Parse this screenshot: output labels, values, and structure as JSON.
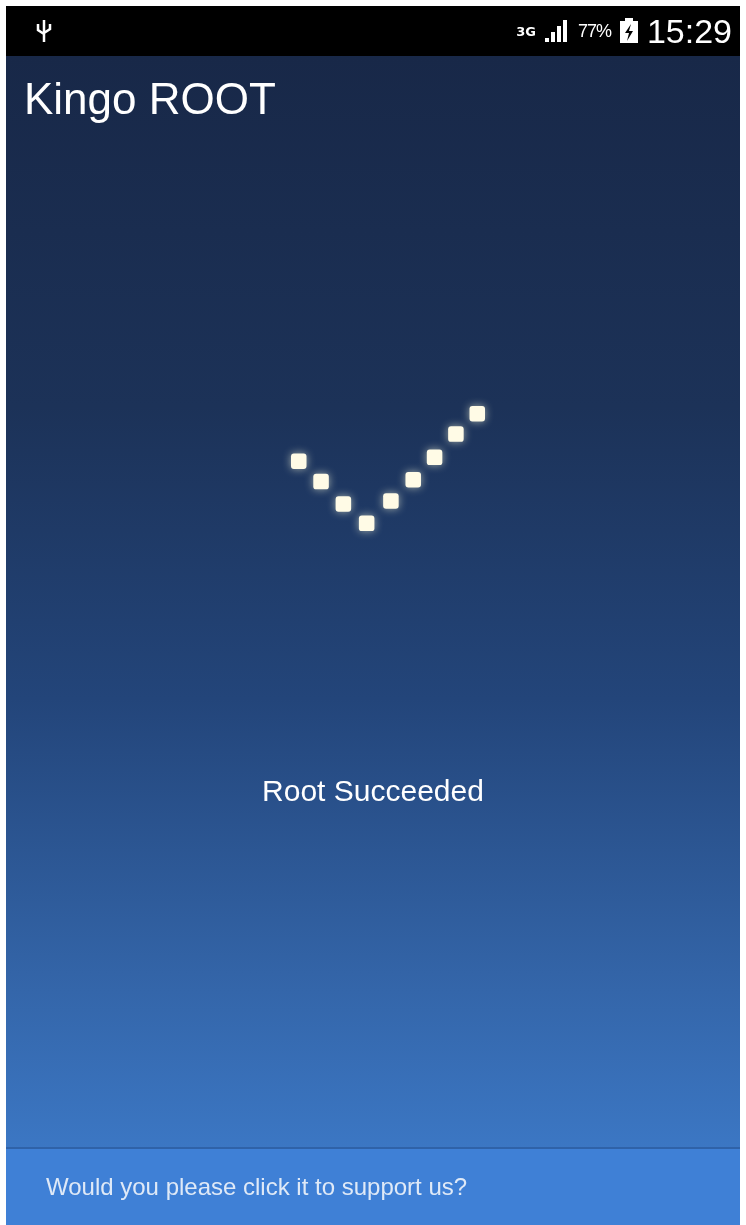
{
  "status_bar": {
    "network": "3G",
    "battery": "77%",
    "time": "15:29"
  },
  "app_bar": {
    "title": "Kingo ROOT"
  },
  "result": {
    "message": "Root Succeeded"
  },
  "footer": {
    "link": "Would you please click it to support us?"
  }
}
